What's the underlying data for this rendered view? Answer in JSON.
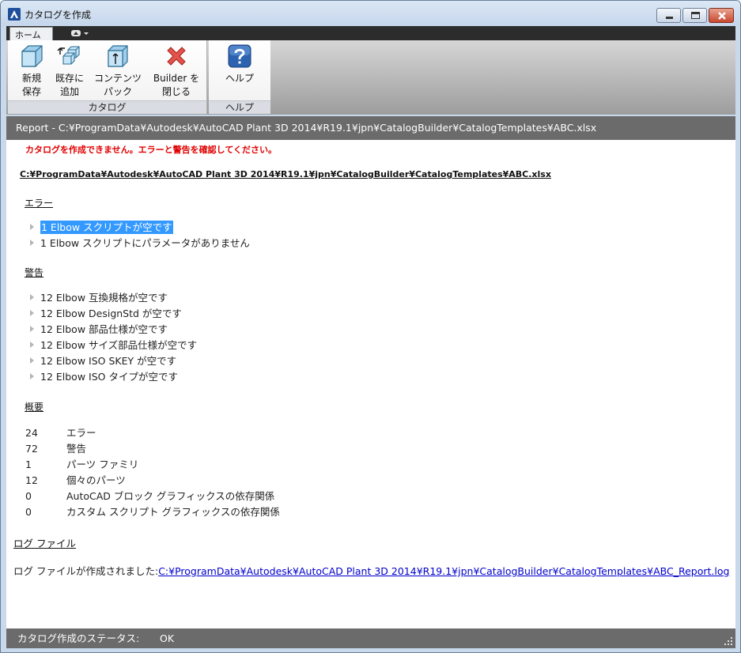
{
  "window": {
    "title": "カタログを作成"
  },
  "ribbon": {
    "tab_home": "ホーム",
    "buttons": {
      "new_save": [
        "新規",
        "保存"
      ],
      "add_existing": [
        "既存に",
        "追加"
      ],
      "content_pack": [
        "コンテンツ",
        "パック"
      ],
      "close_builder": [
        "Builder を",
        "閉じる"
      ],
      "help": "ヘルプ"
    },
    "panels": {
      "catalog": "カタログ",
      "help": "ヘルプ"
    }
  },
  "report": {
    "header": "Report - C:¥ProgramData¥Autodesk¥AutoCAD Plant 3D 2014¥R19.1¥jpn¥CatalogBuilder¥CatalogTemplates¥ABC.xlsx",
    "error_message": "カタログを作成できません。エラーと警告を確認してください。",
    "file_path": "C:¥ProgramData¥Autodesk¥AutoCAD Plant 3D 2014¥R19.1¥jpn¥CatalogBuilder¥CatalogTemplates¥ABC.xlsx",
    "errors_heading": "エラー",
    "errors": [
      {
        "text": "1 Elbow スクリプトが空です",
        "selected": true
      },
      {
        "text": "1 Elbow スクリプトにパラメータがありません",
        "selected": false
      }
    ],
    "warnings_heading": "警告",
    "warnings": [
      "12 Elbow 互換規格が空です",
      "12 Elbow DesignStd が空です",
      "12 Elbow 部品仕様が空です",
      "12 Elbow サイズ部品仕様が空です",
      "12 Elbow ISO SKEY が空です",
      "12 Elbow ISO タイプが空です"
    ],
    "summary_heading": "概要",
    "summary": [
      {
        "count": "24",
        "label": "エラー"
      },
      {
        "count": "72",
        "label": "警告"
      },
      {
        "count": "1",
        "label": "パーツ ファミリ"
      },
      {
        "count": "12",
        "label": "個々のパーツ"
      },
      {
        "count": "0",
        "label": "AutoCAD ブロック グラフィックスの依存関係"
      },
      {
        "count": "0",
        "label": "カスタム スクリプト グラフィックスの依存関係"
      }
    ],
    "log_heading": "ログ ファイル",
    "log_prefix": "ログ ファイルが作成されました:",
    "log_link": "C:¥ProgramData¥Autodesk¥AutoCAD Plant 3D 2014¥R19.1¥jpn¥CatalogBuilder¥CatalogTemplates¥ABC_Report.log"
  },
  "status": {
    "label": "カタログ作成のステータス:",
    "value": "OK"
  },
  "colors": {
    "error_text": "#e00000",
    "selection": "#3399ff",
    "link": "#0000cc",
    "bars": "#6b6b6b"
  }
}
